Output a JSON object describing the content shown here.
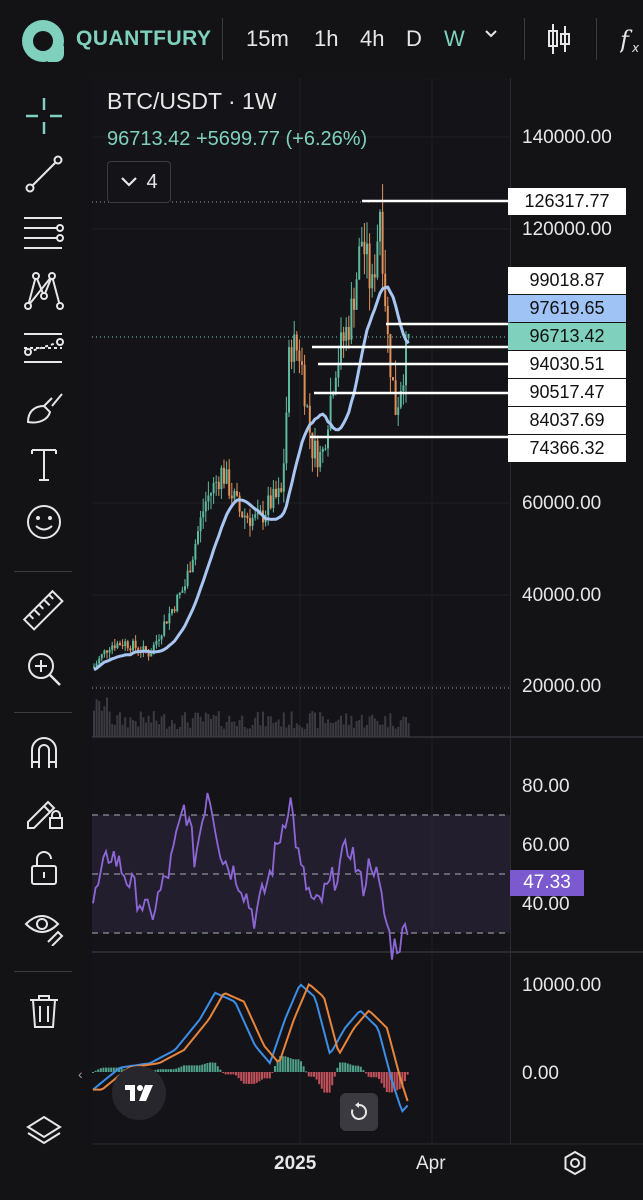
{
  "topbar": {
    "brand": "QUANTFURY",
    "timeframes": [
      "15m",
      "1h",
      "4h",
      "D",
      "W"
    ],
    "active_timeframe": "W",
    "accent": "#7fd1bd"
  },
  "chart": {
    "symbol_title": "BTC/USDT · 1W",
    "quote": "96713.42  +5699.77 (+6.26%)",
    "collapsed_count": "4",
    "y_axis_labels": [
      "140000.00",
      "120000.00",
      "60000.00",
      "40000.00",
      "20000.00"
    ],
    "price_boxes": [
      {
        "label": "126317.77",
        "style": "white"
      },
      {
        "label": "99018.87",
        "style": "white"
      },
      {
        "label": "97619.65",
        "style": "blue"
      },
      {
        "label": "96713.42",
        "style": "teal"
      },
      {
        "label": "94030.51",
        "style": "white"
      },
      {
        "label": "90517.47",
        "style": "white"
      },
      {
        "label": "84037.69",
        "style": "white"
      },
      {
        "label": "74366.32",
        "style": "white"
      }
    ],
    "rsi_labels": [
      "80.00",
      "60.00",
      "40.00"
    ],
    "rsi_value": "47.33",
    "macd_labels": [
      "10000.00",
      "0.00"
    ],
    "x_axis_labels": [
      "2025",
      "Apr"
    ],
    "colors": {
      "up": "#5fb8a0",
      "down": "#e0915a",
      "ma": "#a9c6f2",
      "rsi": "#8c68d6",
      "macd": "#3d8ee6",
      "signal": "#e8853d"
    }
  },
  "icons": {
    "sidebar": [
      "crosshair-icon",
      "trend-line-icon",
      "fib-lines-icon",
      "pattern-icon",
      "projection-icon",
      "brush-icon",
      "text-icon",
      "emoji-icon",
      "ruler-icon",
      "zoom-in-icon",
      "magnet-icon",
      "lock-pencil-icon",
      "unlock-icon",
      "eye-icon",
      "trash-icon",
      "layers-icon"
    ],
    "topbar": [
      "candles-icon",
      "fx-icon"
    ],
    "bottom": [
      "tradingview-logo",
      "reset-icon",
      "settings-icon"
    ]
  }
}
